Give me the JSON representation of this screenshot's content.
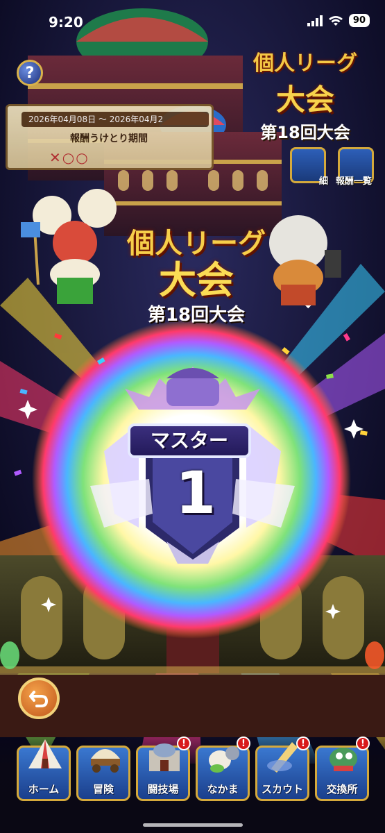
{
  "status_bar": {
    "time": "9:20",
    "battery": "90"
  },
  "event_banner": {
    "dates": "2026年04月08日 ～ 2026年04月2",
    "label": "報酬うけとり期間",
    "marks": "✕○○"
  },
  "small_title": {
    "line1": "個人リーグ",
    "line2": "大会",
    "line3": "第18回大会"
  },
  "side_buttons": [
    {
      "label": "細"
    },
    {
      "label": "報酬一覧"
    }
  ],
  "big_title": {
    "line1": "個人リーグ",
    "line2": "大会",
    "line3": "第18回大会"
  },
  "rank": {
    "label": "マスター",
    "number": "1"
  },
  "nav": {
    "items": [
      {
        "label": "ホーム",
        "badge": ""
      },
      {
        "label": "冒険",
        "badge": ""
      },
      {
        "label": "闘技場",
        "badge": "!"
      },
      {
        "label": "なかま",
        "badge": "!"
      },
      {
        "label": "スカウト",
        "badge": "!"
      },
      {
        "label": "交換所",
        "badge": "!"
      }
    ]
  },
  "colors": {
    "title_gold": "#f7cf4a",
    "badge_purple": "#3b2f7e",
    "nav_blue": "#2a5cb4",
    "frame_gold": "#d4a93c",
    "notify_red": "#d81b1b"
  }
}
